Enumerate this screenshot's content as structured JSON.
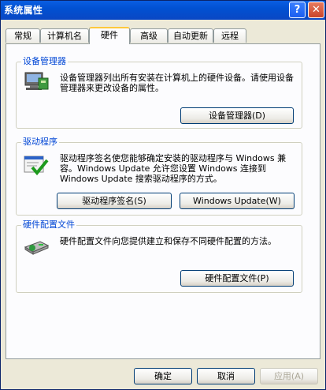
{
  "window": {
    "title": "系统属性",
    "help_label": "?",
    "close_label": "✕"
  },
  "tabs": [
    {
      "label": "常规"
    },
    {
      "label": "计算机名"
    },
    {
      "label": "硬件"
    },
    {
      "label": "高级"
    },
    {
      "label": "自动更新"
    },
    {
      "label": "远程"
    }
  ],
  "active_tab": "硬件",
  "device_manager": {
    "title": "设备管理器",
    "description": "设备管理器列出所有安装在计算机上的硬件设备。请使用设备管理器来更改设备的属性。",
    "button_label": "设备管理器(D)",
    "icon": "device-manager-icon"
  },
  "drivers": {
    "title": "驱动程序",
    "description": "驱动程序签名使您能够确定安装的驱动程序与 Windows 兼容。Windows Update 允许您设置 Windows 连接到 Windows Update 搜索驱动程序的方式。",
    "signing_button_label": "驱动程序签名(S)",
    "update_button_label": "Windows Update(W)",
    "icon": "driver-signing-icon"
  },
  "hardware_profiles": {
    "title": "硬件配置文件",
    "description": "硬件配置文件向您提供建立和保存不同硬件配置的方法。",
    "button_label": "硬件配置文件(P)",
    "icon": "hardware-profile-icon"
  },
  "footer": {
    "ok_label": "确定",
    "cancel_label": "取消",
    "apply_label": "应用(A)"
  }
}
